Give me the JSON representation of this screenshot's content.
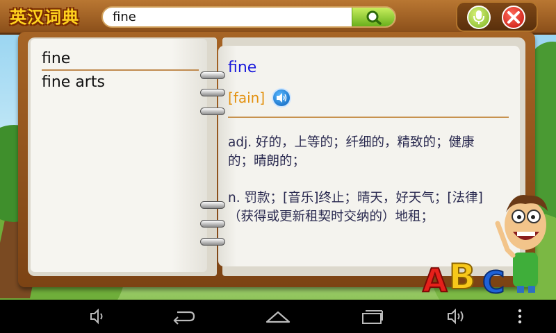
{
  "app": {
    "title": "英汉词典"
  },
  "search": {
    "value": "fine",
    "placeholder": ""
  },
  "word_list": {
    "items": [
      {
        "label": "fine",
        "selected": true
      },
      {
        "label": "fine arts",
        "selected": false
      }
    ]
  },
  "entry": {
    "word": "fine",
    "phonetic": "[fain]",
    "definitions": [
      {
        "text": "adj.  好的，上等的；纤细的，精致的；健康的；晴朗的；"
      },
      {
        "text": "n.  罚款；[音乐]终止；晴天，好天气；[法律]（获得或更新租契时交纳的）地租；"
      }
    ]
  },
  "decorations": {
    "abc_letters": [
      "A",
      "B",
      "C"
    ]
  },
  "colors": {
    "title_yellow": "#ffd21e",
    "word_blue": "#1a1adc",
    "phonetic_orange": "#e39110",
    "divider_brown": "#c7924f",
    "wood": "#8b4f1a"
  },
  "icons": {
    "search": "search-icon",
    "mic": "microphone-icon",
    "close": "close-icon",
    "speaker": "speaker-icon",
    "nav": [
      "volume-down-icon",
      "back-icon",
      "home-icon",
      "recent-apps-icon",
      "volume-up-icon",
      "overflow-menu-icon"
    ]
  }
}
